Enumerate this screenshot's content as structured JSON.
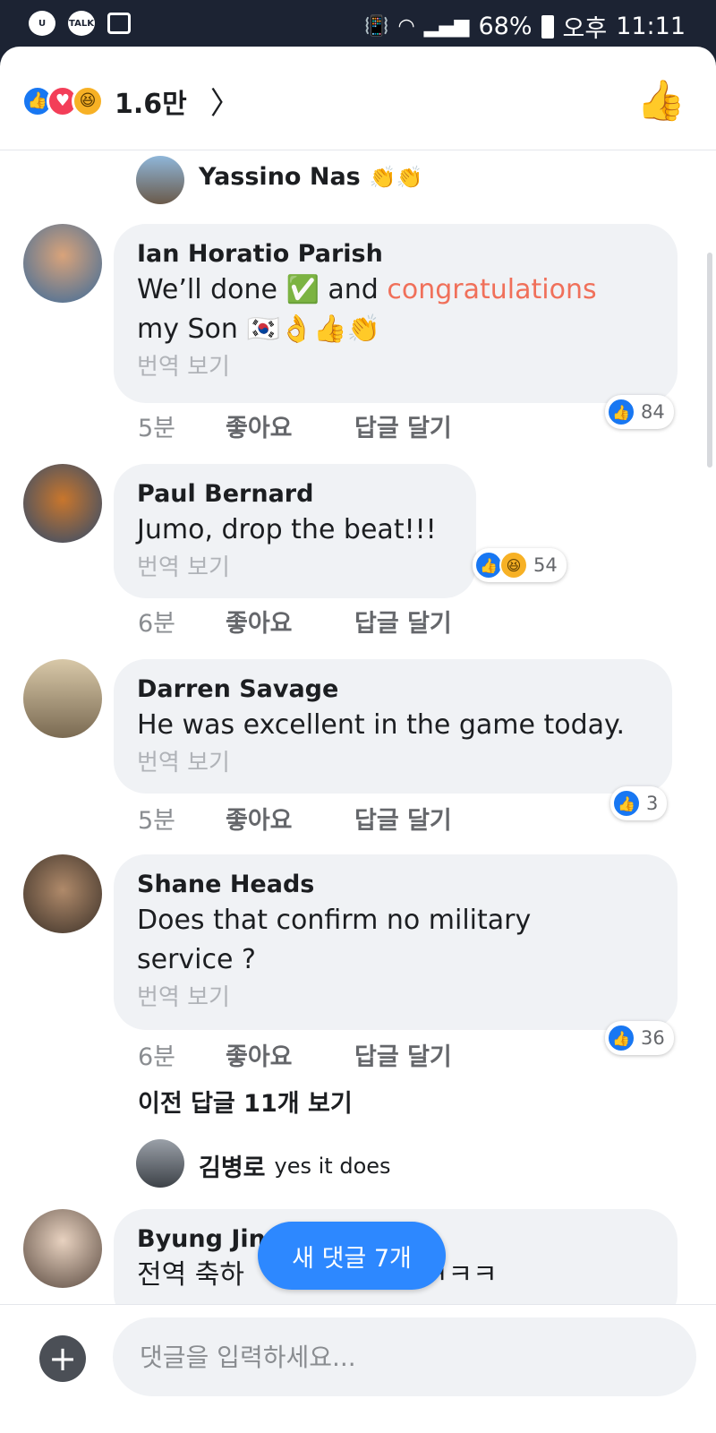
{
  "status_bar": {
    "kakao_label": "TALK",
    "battery": "68%",
    "ampm": "오후",
    "time": "11:11"
  },
  "header": {
    "reaction_count": "1.6만"
  },
  "top_reply": {
    "name": "Yassino Nas",
    "text": "👏👏"
  },
  "comments": [
    {
      "name": "Ian Horatio Parish",
      "text_a": "We’ll done ✅ and ",
      "text_hl": "congratulations",
      "text_b": "my Son 🇰🇷👌👍👏",
      "translate": "번역 보기",
      "time": "5분",
      "like": "좋아요",
      "reply": "답글 달기",
      "reaction_count": "84"
    },
    {
      "name": "Paul Bernard",
      "text": "Jumo, drop the beat!!!",
      "translate": "번역 보기",
      "time": "6분",
      "like": "좋아요",
      "reply": "답글 달기",
      "reaction_count": "54"
    },
    {
      "name": "Darren Savage",
      "text": "He was excellent in the game today.",
      "translate": "번역 보기",
      "time": "5분",
      "like": "좋아요",
      "reply": "답글 달기",
      "reaction_count": "3"
    },
    {
      "name": "Shane Heads",
      "text_a": "Does that confirm no military",
      "text_b": "service ?",
      "translate": "번역 보기",
      "time": "6분",
      "like": "좋아요",
      "reply": "답글 달기",
      "reaction_count": "36"
    },
    {
      "name": "Byung Jin",
      "text_a": "전역 축하",
      "text_b": "ㅋㅋㅋ"
    }
  ],
  "prev_replies": "이전 답글 11개 보기",
  "nested_reply": {
    "name": "김병로",
    "text": "yes it does"
  },
  "new_comments_button": "새 댓글 7개",
  "composer": {
    "placeholder": "댓글을 입력하세요..."
  },
  "colors": {
    "like_blue": "#1877f2",
    "love_red": "#f33e58",
    "haha_yellow": "#f7b125",
    "highlight": "#f0705a",
    "new_button": "#2d88ff"
  }
}
